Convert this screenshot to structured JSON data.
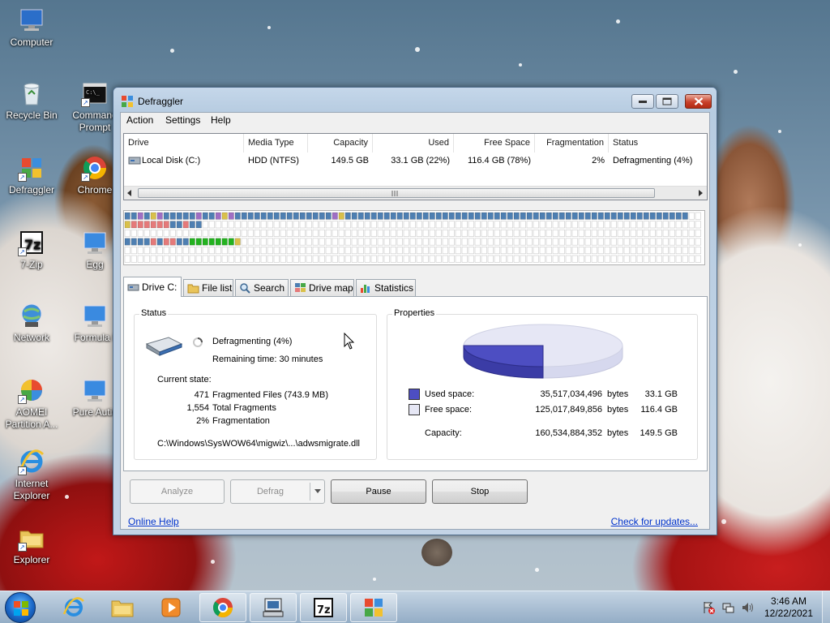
{
  "desktop": {
    "icons": [
      {
        "label": "Computer"
      },
      {
        "label": "Recycle Bin"
      },
      {
        "label": "Command Prompt"
      },
      {
        "label": "Defraggler"
      },
      {
        "label": "Chrome"
      },
      {
        "label": "7-Zip"
      },
      {
        "label": "Egg"
      },
      {
        "label": "Network"
      },
      {
        "label": "Formula I"
      },
      {
        "label": "AOMEI Partition A..."
      },
      {
        "label": "Pure Autis"
      },
      {
        "label": "Internet Explorer"
      },
      {
        "label": "Explorer"
      }
    ]
  },
  "window": {
    "title": "Defraggler",
    "menu": [
      "Action",
      "Settings",
      "Help"
    ]
  },
  "drives": {
    "columns": [
      "Drive",
      "Media Type",
      "Capacity",
      "Used",
      "Free Space",
      "Fragmentation",
      "Status"
    ],
    "rows": [
      {
        "drive": "Local Disk (C:)",
        "media": "HDD (NTFS)",
        "capacity": "149.5 GB",
        "used": "33.1 GB (22%)",
        "free": "116.4 GB (78%)",
        "frag": "2%",
        "status": "Defragmenting (4%)"
      }
    ]
  },
  "tabs": [
    "Drive C:",
    "File list",
    "Search",
    "Drive map",
    "Statistics"
  ],
  "status": {
    "title": "Status",
    "state_line": "Defragmenting (4%)",
    "remaining": "Remaining time: 30 minutes",
    "current_state_label": "Current state:",
    "stats": [
      {
        "value": "471",
        "label": "Fragmented Files (743.9 MB)"
      },
      {
        "value": "1,554",
        "label": "Total Fragments"
      },
      {
        "value": "2%",
        "label": "Fragmentation"
      }
    ],
    "current_file": "C:\\Windows\\SysWOW64\\migwiz\\...\\adwsmigrate.dll"
  },
  "properties": {
    "title": "Properties",
    "used_fraction": 0.22,
    "rows": [
      {
        "label": "Used space:",
        "bytes": "35,517,034,496",
        "unit": "bytes",
        "size": "33.1 GB"
      },
      {
        "label": "Free space:",
        "bytes": "125,017,849,856",
        "unit": "bytes",
        "size": "116.4 GB"
      },
      {
        "label": "Capacity:",
        "bytes": "160,534,884,352",
        "unit": "bytes",
        "size": "149.5 GB"
      }
    ],
    "colors": {
      "used": "#4d4ec2",
      "free": "#e6e7f5"
    }
  },
  "buttons": {
    "analyze": "Analyze",
    "defrag": "Defrag",
    "pause": "Pause",
    "stop": "Stop"
  },
  "links": {
    "help": "Online Help",
    "updates": "Check for updates..."
  },
  "clustermap": {
    "legend_colors": {
      "used": "#4e7fb2",
      "fragmented": "#e57a7a",
      "processing": "#23b21f",
      "free": "#ffffff",
      "mft": "#d9c04a",
      "system": "#9f6fc4"
    },
    "rows": [
      "uuPuYPuuuuuPuuPYPuuuuuuuuuuuuuuuPYuuuuuuuuuuuuuuuuuuuuuuuuuuuuuuuuuuuuuuuuuuuuuuuuuuuuu",
      "YFFFFFFuuFuu..............................................................................",
      "..........................................................................................",
      "uuuuFuFFuuGGGGGGGY........................................................................",
      "..........................................................................................",
      ".........................................................................................."
    ]
  },
  "taskbar": {
    "time": "3:46 AM",
    "date": "12/22/2021"
  }
}
